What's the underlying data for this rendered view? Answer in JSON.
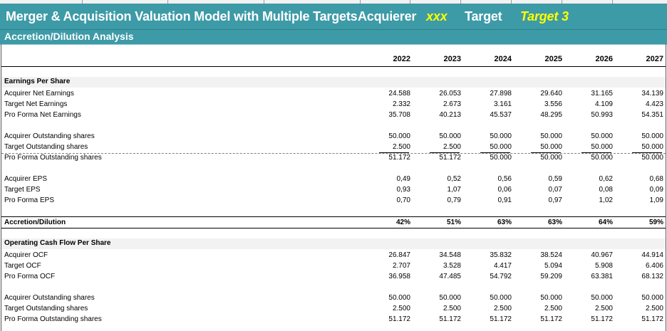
{
  "header": {
    "title": "Merger & Acquisition Valuation Model with Multiple Targets",
    "acquirer_label": "Acquierer",
    "acquirer_value": "xxx",
    "target_label": "Target",
    "target_value": "Target 3"
  },
  "subheader": "Accretion/Dilution Analysis",
  "years": [
    "2022",
    "2023",
    "2024",
    "2025",
    "2026",
    "2027"
  ],
  "eps_section": {
    "title": "Earnings Per Share",
    "net_earnings": [
      {
        "label": "Acquirer Net Earnings",
        "values": [
          "24.588",
          "26.053",
          "27.898",
          "29.640",
          "31.165",
          "34.139"
        ]
      },
      {
        "label": "Target Net Earnings",
        "values": [
          "2.332",
          "2.673",
          "3.161",
          "3.556",
          "4.109",
          "4.423"
        ]
      },
      {
        "label": "Pro Forma Net Earnings",
        "values": [
          "35.708",
          "40.213",
          "45.537",
          "48.295",
          "50.993",
          "54.351"
        ]
      }
    ],
    "shares": [
      {
        "label": "Acquirer Outstanding shares",
        "values": [
          "50.000",
          "50.000",
          "50.000",
          "50.000",
          "50.000",
          "50.000"
        ]
      },
      {
        "label": "Target Outstanding shares",
        "values": [
          "2.500",
          "2.500",
          "50.000",
          "50.000",
          "50.000",
          "50.000"
        ]
      },
      {
        "label": "Pro Forma Outstanding shares",
        "values": [
          "51.172",
          "51.172",
          "50.000",
          "50.000",
          "50.000",
          "50.000"
        ]
      }
    ],
    "eps": [
      {
        "label": "Acquirer EPS",
        "values": [
          "0,49",
          "0,52",
          "0,56",
          "0,59",
          "0,62",
          "0,68"
        ]
      },
      {
        "label": "Target EPS",
        "values": [
          "0,93",
          "1,07",
          "0,06",
          "0,07",
          "0,08",
          "0,09"
        ]
      },
      {
        "label": "Pro Forma EPS",
        "values": [
          "0,70",
          "0,79",
          "0,91",
          "0,97",
          "1,02",
          "1,09"
        ]
      }
    ]
  },
  "accretion": {
    "label": "Accretion/Dilution",
    "values": [
      "42%",
      "51%",
      "63%",
      "63%",
      "64%",
      "59%"
    ]
  },
  "ocf_section": {
    "title": "Operating Cash Flow Per Share",
    "ocf": [
      {
        "label": "Acquirer OCF",
        "values": [
          "26.847",
          "34.548",
          "35.832",
          "38.524",
          "40.967",
          "44.914"
        ]
      },
      {
        "label": "Target OCF",
        "values": [
          "2.707",
          "3.528",
          "4.417",
          "5.094",
          "5.908",
          "6.406"
        ]
      },
      {
        "label": "Pro Forma OCF",
        "values": [
          "36.958",
          "47.485",
          "54.792",
          "59.209",
          "63.381",
          "68.132"
        ]
      }
    ],
    "shares": [
      {
        "label": "Acquirer Outstanding shares",
        "values": [
          "50.000",
          "50.000",
          "50.000",
          "50.000",
          "50.000",
          "50.000"
        ]
      },
      {
        "label": "Target Outstanding shares",
        "values": [
          "2.500",
          "2.500",
          "2.500",
          "2.500",
          "2.500",
          "2.500"
        ]
      },
      {
        "label": "Pro Forma Outstanding shares",
        "values": [
          "51.172",
          "51.172",
          "51.172",
          "51.172",
          "51.172",
          "51.172"
        ]
      }
    ]
  }
}
